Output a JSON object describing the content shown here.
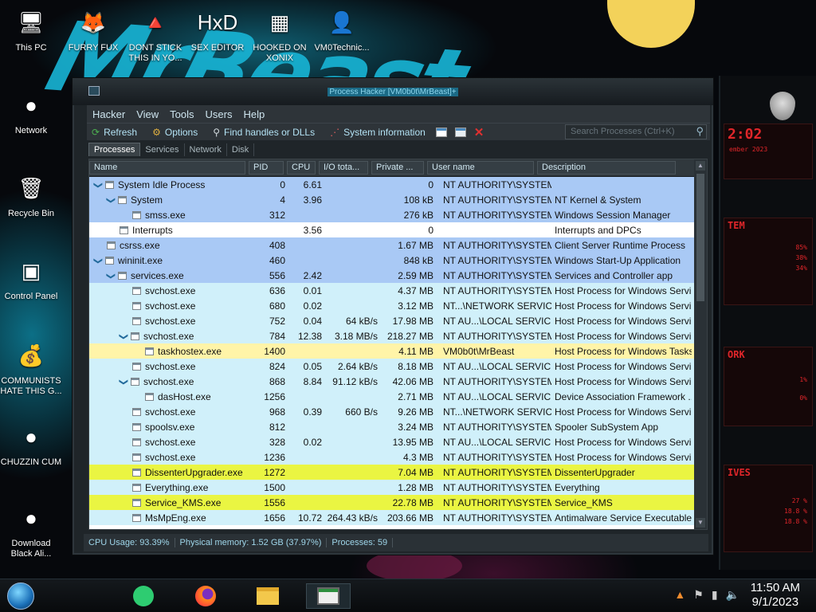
{
  "wallpaper": {
    "text": "MrBeast"
  },
  "desktop_icons": [
    {
      "name": "this-pc",
      "label": "This PC",
      "glyph": "🖥"
    },
    {
      "name": "furry-fux",
      "label": "FURRY FUX",
      "glyph": "🦊"
    },
    {
      "name": "dont-stick",
      "label": "DONT STICK THIS IN YO...",
      "glyph": "🔺"
    },
    {
      "name": "sex-editor",
      "label": "SEX EDITOR",
      "glyph": "HxD"
    },
    {
      "name": "hooked-on-xonix",
      "label": "HOOKED ON XONIX",
      "glyph": "▦"
    },
    {
      "name": "vm0technic",
      "label": "VM0Technic...",
      "glyph": "👤"
    },
    {
      "name": "network",
      "label": "Network",
      "glyph": "●"
    },
    {
      "name": "recycle-bin",
      "label": "Recycle Bin",
      "glyph": "🗑"
    },
    {
      "name": "control-panel",
      "label": "Control Panel",
      "glyph": "▣"
    },
    {
      "name": "communists",
      "label": "COMMUNISTS HATE THIS G...",
      "glyph": "💰"
    },
    {
      "name": "chuzzin-cum",
      "label": "CHUZZIN CUM",
      "glyph": "●"
    },
    {
      "name": "download-black-ali",
      "label": "Download Black Ali...",
      "glyph": "●"
    }
  ],
  "window": {
    "title": "Process Hacker [VM0b0t\\MrBeast]+",
    "menu": [
      "Hacker",
      "View",
      "Tools",
      "Users",
      "Help"
    ],
    "toolbar": {
      "refresh": "Refresh",
      "options": "Options",
      "find": "Find handles or DLLs",
      "sysinfo": "System information"
    },
    "search_placeholder": "Search Processes (Ctrl+K)",
    "tabs": [
      "Processes",
      "Services",
      "Network",
      "Disk"
    ],
    "columns": [
      "Name",
      "PID",
      "CPU",
      "I/O tota...",
      "Private ...",
      "User name",
      "Description"
    ],
    "rows": [
      {
        "name": "System Idle Process",
        "pid": "0",
        "cpu": "6.61",
        "io": "",
        "priv": "0",
        "user": "NT AUTHORITY\\SYSTEM",
        "desc": "",
        "indent": 0,
        "chev": true,
        "color": "#a9c9f5"
      },
      {
        "name": "System",
        "pid": "4",
        "cpu": "3.96",
        "io": "",
        "priv": "108 kB",
        "user": "NT AUTHORITY\\SYSTEM",
        "desc": "NT Kernel & System",
        "indent": 1,
        "chev": true,
        "color": "#a9c9f5"
      },
      {
        "name": "smss.exe",
        "pid": "312",
        "cpu": "",
        "io": "",
        "priv": "276 kB",
        "user": "NT AUTHORITY\\SYSTEM",
        "desc": "Windows Session Manager",
        "indent": 3,
        "chev": false,
        "color": "#a9c9f5"
      },
      {
        "name": "Interrupts",
        "pid": "",
        "cpu": "3.56",
        "io": "",
        "priv": "0",
        "user": "",
        "desc": "Interrupts and DPCs",
        "indent": 2,
        "chev": false,
        "color": "#ffffff"
      },
      {
        "name": "csrss.exe",
        "pid": "408",
        "cpu": "",
        "io": "",
        "priv": "1.67 MB",
        "user": "NT AUTHORITY\\SYSTEM",
        "desc": "Client Server Runtime Process",
        "indent": 1,
        "chev": false,
        "color": "#a9c9f5"
      },
      {
        "name": "wininit.exe",
        "pid": "460",
        "cpu": "",
        "io": "",
        "priv": "848 kB",
        "user": "NT AUTHORITY\\SYSTEM",
        "desc": "Windows Start-Up Application",
        "indent": 0,
        "chev": true,
        "color": "#a9c9f5"
      },
      {
        "name": "services.exe",
        "pid": "556",
        "cpu": "2.42",
        "io": "",
        "priv": "2.59 MB",
        "user": "NT AUTHORITY\\SYSTEM",
        "desc": "Services and Controller app",
        "indent": 1,
        "chev": true,
        "color": "#a9c9f5"
      },
      {
        "name": "svchost.exe",
        "pid": "636",
        "cpu": "0.01",
        "io": "",
        "priv": "4.37 MB",
        "user": "NT AUTHORITY\\SYSTEM",
        "desc": "Host Process for Windows Servi...",
        "indent": 3,
        "chev": false,
        "color": "#d0f0fa"
      },
      {
        "name": "svchost.exe",
        "pid": "680",
        "cpu": "0.02",
        "io": "",
        "priv": "3.12 MB",
        "user": "NT...\\NETWORK SERVICE",
        "desc": "Host Process for Windows Servi...",
        "indent": 3,
        "chev": false,
        "color": "#d0f0fa"
      },
      {
        "name": "svchost.exe",
        "pid": "752",
        "cpu": "0.04",
        "io": "64 kB/s",
        "priv": "17.98 MB",
        "user": "NT AU...\\LOCAL SERVICE",
        "desc": "Host Process for Windows Servi...",
        "indent": 3,
        "chev": false,
        "color": "#d0f0fa"
      },
      {
        "name": "svchost.exe",
        "pid": "784",
        "cpu": "12.38",
        "io": "3.18 MB/s",
        "priv": "218.27 MB",
        "user": "NT AUTHORITY\\SYSTEM",
        "desc": "Host Process for Windows Servi...",
        "indent": 2,
        "chev": true,
        "color": "#d0f0fa"
      },
      {
        "name": "taskhostex.exe",
        "pid": "1400",
        "cpu": "",
        "io": "",
        "priv": "4.11 MB",
        "user": "VM0b0t\\MrBeast",
        "desc": "Host Process for Windows Tasks",
        "indent": 4,
        "chev": false,
        "color": "#fff4a8"
      },
      {
        "name": "svchost.exe",
        "pid": "824",
        "cpu": "0.05",
        "io": "2.64 kB/s",
        "priv": "8.18 MB",
        "user": "NT AU...\\LOCAL SERVICE",
        "desc": "Host Process for Windows Servi...",
        "indent": 3,
        "chev": false,
        "color": "#d0f0fa"
      },
      {
        "name": "svchost.exe",
        "pid": "868",
        "cpu": "8.84",
        "io": "91.12 kB/s",
        "priv": "42.06 MB",
        "user": "NT AUTHORITY\\SYSTEM",
        "desc": "Host Process for Windows Servi...",
        "indent": 2,
        "chev": true,
        "color": "#d0f0fa"
      },
      {
        "name": "dasHost.exe",
        "pid": "1256",
        "cpu": "",
        "io": "",
        "priv": "2.71 MB",
        "user": "NT AU...\\LOCAL SERVICE",
        "desc": "Device Association Framework ...",
        "indent": 4,
        "chev": false,
        "color": "#d0f0fa"
      },
      {
        "name": "svchost.exe",
        "pid": "968",
        "cpu": "0.39",
        "io": "660 B/s",
        "priv": "9.26 MB",
        "user": "NT...\\NETWORK SERVICE",
        "desc": "Host Process for Windows Servi...",
        "indent": 3,
        "chev": false,
        "color": "#d0f0fa"
      },
      {
        "name": "spoolsv.exe",
        "pid": "812",
        "cpu": "",
        "io": "",
        "priv": "3.24 MB",
        "user": "NT AUTHORITY\\SYSTEM",
        "desc": "Spooler SubSystem App",
        "indent": 3,
        "chev": false,
        "color": "#d0f0fa"
      },
      {
        "name": "svchost.exe",
        "pid": "328",
        "cpu": "0.02",
        "io": "",
        "priv": "13.95 MB",
        "user": "NT AU...\\LOCAL SERVICE",
        "desc": "Host Process for Windows Servi...",
        "indent": 3,
        "chev": false,
        "color": "#d0f0fa"
      },
      {
        "name": "svchost.exe",
        "pid": "1236",
        "cpu": "",
        "io": "",
        "priv": "4.3 MB",
        "user": "NT AUTHORITY\\SYSTEM",
        "desc": "Host Process for Windows Servi...",
        "indent": 3,
        "chev": false,
        "color": "#d0f0fa"
      },
      {
        "name": "DissenterUpgrader.exe",
        "pid": "1272",
        "cpu": "",
        "io": "",
        "priv": "7.04 MB",
        "user": "NT AUTHORITY\\SYSTEM",
        "desc": "DissenterUpgrader",
        "indent": 3,
        "chev": false,
        "color": "#eaf542"
      },
      {
        "name": "Everything.exe",
        "pid": "1500",
        "cpu": "",
        "io": "",
        "priv": "1.28 MB",
        "user": "NT AUTHORITY\\SYSTEM",
        "desc": "Everything",
        "indent": 3,
        "chev": false,
        "color": "#d0f0fa"
      },
      {
        "name": "Service_KMS.exe",
        "pid": "1556",
        "cpu": "",
        "io": "",
        "priv": "22.78 MB",
        "user": "NT AUTHORITY\\SYSTEM",
        "desc": "Service_KMS",
        "indent": 3,
        "chev": false,
        "color": "#eaf542"
      },
      {
        "name": "MsMpEng.exe",
        "pid": "1656",
        "cpu": "10.72",
        "io": "264.43 kB/s",
        "priv": "203.66 MB",
        "user": "NT AUTHORITY\\SYSTEM",
        "desc": "Antimalware Service Executable",
        "indent": 3,
        "chev": false,
        "color": "#d0f0fa"
      }
    ],
    "status": {
      "cpu": "CPU Usage: 93.39%",
      "memory": "Physical memory: 1.52 GB (37.97%)",
      "processes": "Processes: 59"
    }
  },
  "gadget": {
    "clock": "2:02",
    "date": "ember 2023",
    "sys_label": "TEM",
    "sys_values": [
      "85%",
      "38%",
      "34%"
    ],
    "net_label": "ORK",
    "net_values": [
      "1%",
      "0%"
    ],
    "disk_label": "IVES",
    "disk_values": [
      "27 %",
      "18.8 %",
      "18.8 %"
    ]
  },
  "taskbar": {
    "time": "11:50 AM",
    "date": "9/1/2023"
  }
}
